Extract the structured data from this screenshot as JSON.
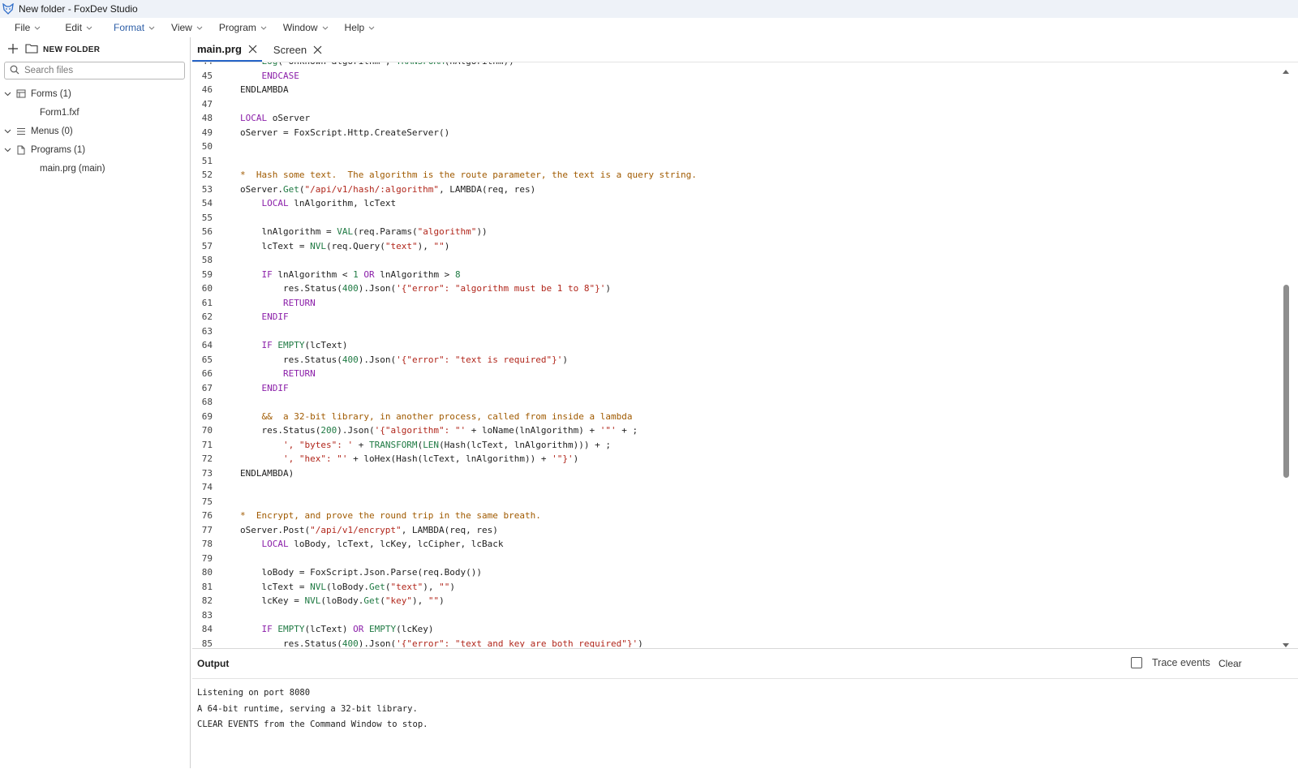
{
  "window": {
    "title": "New folder - FoxDev Studio"
  },
  "menubar": {
    "items": [
      "File",
      "Edit",
      "Format",
      "View",
      "Program",
      "Window",
      "Help"
    ]
  },
  "sidebar": {
    "folder_title": "NEW FOLDER",
    "search_placeholder": "Search files",
    "tree": {
      "forms": {
        "label": "Forms (1)",
        "children": [
          "Form1.fxf"
        ]
      },
      "menus": {
        "label": "Menus (0)"
      },
      "programs": {
        "label": "Programs (1)",
        "children": [
          "main.prg (main)"
        ]
      }
    }
  },
  "tabs": [
    "main.prg",
    "Screen"
  ],
  "editor": {
    "first_line_number": 44,
    "lines": [
      [
        [
          "ct",
          "    "
        ],
        [
          "fn",
          "Log"
        ],
        [
          "ct",
          "(\"Unknown algorithm\", "
        ],
        [
          "fn",
          "TRANSFORM"
        ],
        [
          "ct",
          "(nAlgorithm))"
        ]
      ],
      [
        [
          "ct",
          "    "
        ],
        [
          "kw",
          "ENDCASE"
        ]
      ],
      [
        [
          "ct",
          "ENDLAMBDA"
        ]
      ],
      [],
      [
        [
          "kw",
          "LOCAL"
        ],
        [
          "ct",
          " oServer"
        ]
      ],
      [
        [
          "ct",
          "oServer = FoxScript.Http.CreateServer()"
        ]
      ],
      [],
      [],
      [
        [
          "cmt",
          "*  Hash some text.  The algorithm is the route parameter, the text is a query string."
        ]
      ],
      [
        [
          "ct",
          "oServer."
        ],
        [
          "fn",
          "Get"
        ],
        [
          "ct",
          "("
        ],
        [
          "str",
          "\"/api/v1/hash/:algorithm\""
        ],
        [
          "ct",
          ", LAMBDA(req, res)"
        ]
      ],
      [
        [
          "ct",
          "    "
        ],
        [
          "kw",
          "LOCAL"
        ],
        [
          "ct",
          " lnAlgorithm, lcText"
        ]
      ],
      [],
      [
        [
          "ct",
          "    lnAlgorithm = "
        ],
        [
          "fn",
          "VAL"
        ],
        [
          "ct",
          "(req.Params("
        ],
        [
          "str",
          "\"algorithm\""
        ],
        [
          "ct",
          "))"
        ]
      ],
      [
        [
          "ct",
          "    lcText = "
        ],
        [
          "fn",
          "NVL"
        ],
        [
          "ct",
          "(req.Query("
        ],
        [
          "str",
          "\"text\""
        ],
        [
          "ct",
          "), "
        ],
        [
          "str",
          "\"\""
        ],
        [
          "ct",
          ")"
        ]
      ],
      [],
      [
        [
          "ct",
          "    "
        ],
        [
          "kw",
          "IF"
        ],
        [
          "ct",
          " lnAlgorithm < "
        ],
        [
          "num",
          "1"
        ],
        [
          "ct",
          " "
        ],
        [
          "kw",
          "OR"
        ],
        [
          "ct",
          " lnAlgorithm > "
        ],
        [
          "num",
          "8"
        ]
      ],
      [
        [
          "ct",
          "        res.Status("
        ],
        [
          "num",
          "400"
        ],
        [
          "ct",
          ").Json("
        ],
        [
          "str",
          "'{\"error\": \"algorithm must be 1 to 8\"}'"
        ],
        [
          "ct",
          ")"
        ]
      ],
      [
        [
          "ct",
          "        "
        ],
        [
          "kw",
          "RETURN"
        ]
      ],
      [
        [
          "ct",
          "    "
        ],
        [
          "kw",
          "ENDIF"
        ]
      ],
      [],
      [
        [
          "ct",
          "    "
        ],
        [
          "kw",
          "IF"
        ],
        [
          "ct",
          " "
        ],
        [
          "fn",
          "EMPTY"
        ],
        [
          "ct",
          "(lcText)"
        ]
      ],
      [
        [
          "ct",
          "        res.Status("
        ],
        [
          "num",
          "400"
        ],
        [
          "ct",
          ").Json("
        ],
        [
          "str",
          "'{\"error\": \"text is required\"}'"
        ],
        [
          "ct",
          ")"
        ]
      ],
      [
        [
          "ct",
          "        "
        ],
        [
          "kw",
          "RETURN"
        ]
      ],
      [
        [
          "ct",
          "    "
        ],
        [
          "kw",
          "ENDIF"
        ]
      ],
      [],
      [
        [
          "ct",
          "    "
        ],
        [
          "cmt",
          "&&  a 32-bit library, in another process, called from inside a lambda"
        ]
      ],
      [
        [
          "ct",
          "    res.Status("
        ],
        [
          "num",
          "200"
        ],
        [
          "ct",
          ").Json("
        ],
        [
          "str",
          "'{\"algorithm\": \"'"
        ],
        [
          "ct",
          " + loName(lnAlgorithm) + "
        ],
        [
          "str",
          "'\"'"
        ],
        [
          "ct",
          " + ;"
        ]
      ],
      [
        [
          "ct",
          "        "
        ],
        [
          "str",
          "', \"bytes\": '"
        ],
        [
          "ct",
          " + "
        ],
        [
          "fn",
          "TRANSFORM"
        ],
        [
          "ct",
          "("
        ],
        [
          "fn",
          "LEN"
        ],
        [
          "ct",
          "(Hash(lcText, lnAlgorithm))) + ;"
        ]
      ],
      [
        [
          "ct",
          "        "
        ],
        [
          "str",
          "', \"hex\": \"'"
        ],
        [
          "ct",
          " + loHex(Hash(lcText, lnAlgorithm)) + "
        ],
        [
          "str",
          "'\"}'"
        ],
        [
          "ct",
          ")"
        ]
      ],
      [
        [
          "ct",
          "ENDLAMBDA)"
        ]
      ],
      [],
      [],
      [
        [
          "cmt",
          "*  Encrypt, and prove the round trip in the same breath."
        ]
      ],
      [
        [
          "ct",
          "oServer.Post("
        ],
        [
          "str",
          "\"/api/v1/encrypt\""
        ],
        [
          "ct",
          ", LAMBDA(req, res)"
        ]
      ],
      [
        [
          "ct",
          "    "
        ],
        [
          "kw",
          "LOCAL"
        ],
        [
          "ct",
          " loBody, lcText, lcKey, lcCipher, lcBack"
        ]
      ],
      [],
      [
        [
          "ct",
          "    loBody = FoxScript.Json.Parse(req.Body())"
        ]
      ],
      [
        [
          "ct",
          "    lcText = "
        ],
        [
          "fn",
          "NVL"
        ],
        [
          "ct",
          "(loBody."
        ],
        [
          "fn",
          "Get"
        ],
        [
          "ct",
          "("
        ],
        [
          "str",
          "\"text\""
        ],
        [
          "ct",
          "), "
        ],
        [
          "str",
          "\"\""
        ],
        [
          "ct",
          ")"
        ]
      ],
      [
        [
          "ct",
          "    lcKey = "
        ],
        [
          "fn",
          "NVL"
        ],
        [
          "ct",
          "(loBody."
        ],
        [
          "fn",
          "Get"
        ],
        [
          "ct",
          "("
        ],
        [
          "str",
          "\"key\""
        ],
        [
          "ct",
          "), "
        ],
        [
          "str",
          "\"\""
        ],
        [
          "ct",
          ")"
        ]
      ],
      [],
      [
        [
          "ct",
          "    "
        ],
        [
          "kw",
          "IF"
        ],
        [
          "ct",
          " "
        ],
        [
          "fn",
          "EMPTY"
        ],
        [
          "ct",
          "(lcText) "
        ],
        [
          "kw",
          "OR"
        ],
        [
          "ct",
          " "
        ],
        [
          "fn",
          "EMPTY"
        ],
        [
          "ct",
          "(lcKey)"
        ]
      ],
      [
        [
          "ct",
          "        res.Status("
        ],
        [
          "num",
          "400"
        ],
        [
          "ct",
          ").Json("
        ],
        [
          "str",
          "'{\"error\": \"text and key are both required\"}'"
        ],
        [
          "ct",
          ")"
        ]
      ]
    ]
  },
  "output": {
    "title": "Output",
    "trace_label": "Trace events",
    "trace_checked": false,
    "clear_label": "Clear",
    "lines": [
      "Listening on port 8080",
      "A 64-bit runtime, serving a 32-bit library.",
      "CLEAR EVENTS from the Command Window to stop."
    ]
  }
}
